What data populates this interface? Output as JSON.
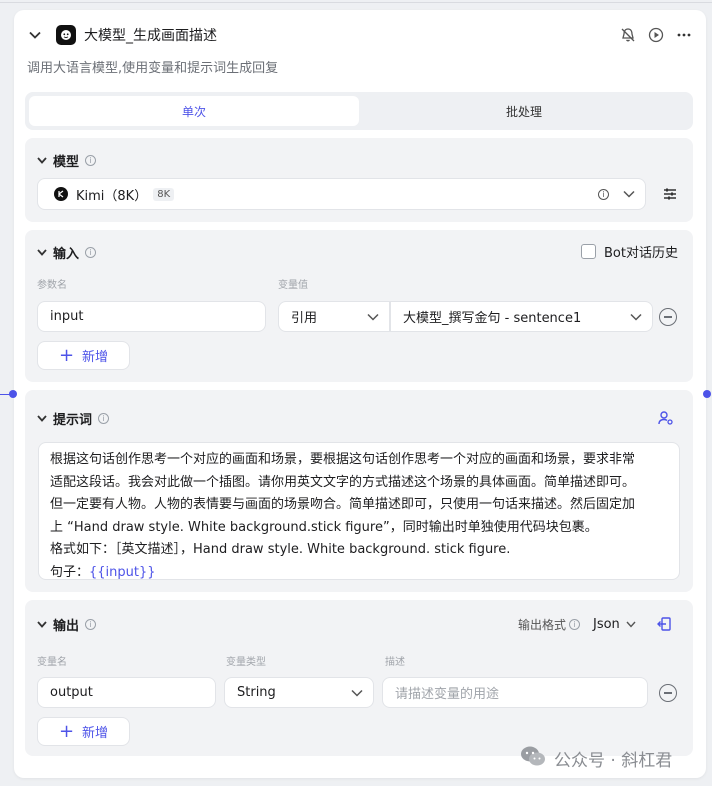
{
  "node": {
    "title": "大模型_生成画面描述",
    "description": "调用大语言模型,使用变量和提示词生成回复"
  },
  "tabs": [
    {
      "label": "单次",
      "active": true
    },
    {
      "label": "批处理",
      "active": false
    }
  ],
  "model_section": {
    "title": "模型",
    "model_name": "Kimi（8K）",
    "model_badge": "8K"
  },
  "input_section": {
    "title": "输入",
    "bot_history_label": "Bot对话历史",
    "col_param_name": "参数名",
    "col_var_value": "变量值",
    "rows": [
      {
        "name": "input",
        "source_type": "引用",
        "source_value": "大模型_撰写金句 - sentence1"
      }
    ],
    "add_label": "新增"
  },
  "prompt_section": {
    "title": "提示词",
    "lines": [
      "根据这句话创作思考一个对应的画面和场景，要根据这句话创作思考一个对应的画面和场景，要求非常",
      "适配这段话。我会对此做一个插图。请你用英文文字的方式描述这个场景的具体画面。简单描述即可。",
      "但一定要有人物。人物的表情要与画面的场景吻合。简单描述即可，只使用一句话来描述。然后固定加",
      "上 “Hand draw style. White background.stick figure”，同时输出时单独使用代码块包裹。",
      "格式如下：［英文描述］，Hand draw style. White background. stick figure."
    ],
    "last_line_prefix": "句子：",
    "last_line_var": "{{input}}"
  },
  "output_section": {
    "title": "输出",
    "format_label": "输出格式",
    "format_value": "Json",
    "col_var_name": "变量名",
    "col_var_type": "变量类型",
    "col_desc": "描述",
    "rows": [
      {
        "name": "output",
        "type": "String",
        "desc_placeholder": "请描述变量的用途"
      }
    ],
    "add_label": "新增"
  },
  "watermark": "公众号 · 斜杠君",
  "colors": {
    "accent": "#4d53e8",
    "section_bg": "#f2f3f5",
    "page_bg": "#eef0f3"
  }
}
